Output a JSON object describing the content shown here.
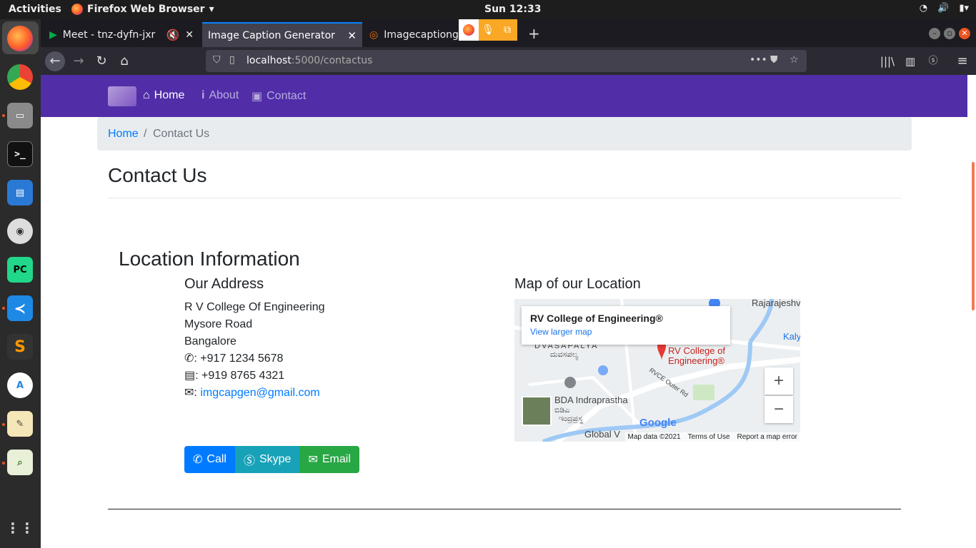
{
  "system": {
    "activities": "Activities",
    "app_menu": "Firefox Web Browser",
    "clock": "Sun 12:33"
  },
  "tabs": [
    {
      "title": "Meet - tnz-dyfn-jxr"
    },
    {
      "title": "Image Caption Generator"
    },
    {
      "title": "Imagecaptionge"
    }
  ],
  "urlbar": {
    "host": "localhost",
    "path": ":5000/contactus"
  },
  "site_nav": {
    "home": "Home",
    "about": "About",
    "contact": "Contact"
  },
  "breadcrumb": {
    "home": "Home",
    "sep": "/",
    "current": "Contact Us"
  },
  "page": {
    "title": "Contact Us",
    "location_heading": "Location Information",
    "address_heading": "Our Address",
    "map_heading": "Map of our Location"
  },
  "address": {
    "line1": "R V College Of Engineering",
    "line2": "Mysore Road",
    "line3": "Bangalore",
    "phone": ": +917 1234 5678",
    "fax": ": +919 8765 4321",
    "email_prefix": ":",
    "email": "imgcapgen@gmail.com"
  },
  "buttons": {
    "call": "Call",
    "skype": "Skype",
    "email": "Email"
  },
  "map": {
    "place_name": "RV College of Engineering®",
    "view_larger": "View larger map",
    "pin_label_1": "RV College of",
    "pin_label_2": "Engineering®",
    "label_bda": "BDA Indraprastha",
    "label_dvs": "DVASAPALYA",
    "label_dvs_kn": "ದುವಸಪಲ್ಯ",
    "label_bda_kn_1": "ಬಿಡಿಎ",
    "label_bda_kn_2": "ಇಂದ್ರಪ್ರಸ್ಥ",
    "label_raj": "Rajarajeshv",
    "label_kaly": "Kaly",
    "label_global": "Global V",
    "label_road": "RVCE Outer Rd",
    "google": "Google",
    "map_data": "Map data ©2021",
    "terms": "Terms of Use",
    "report": "Report a map error",
    "zoom_in": "+",
    "zoom_out": "−"
  }
}
